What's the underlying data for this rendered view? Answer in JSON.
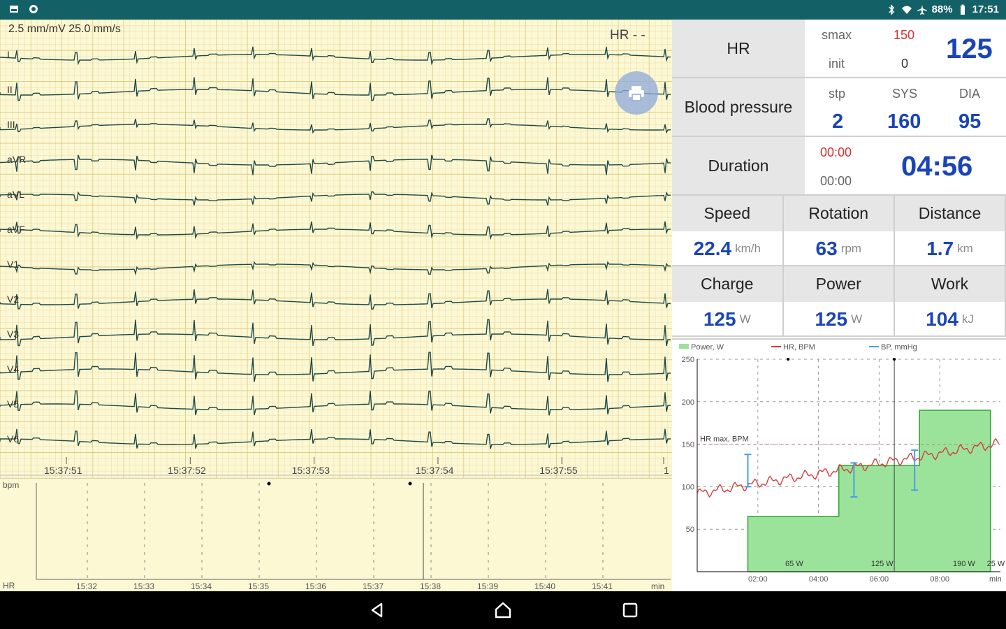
{
  "status_bar": {
    "left_icons": [
      "image-icon",
      "sync-icon"
    ],
    "right_icons": [
      "bluetooth-icon",
      "wifi-icon",
      "airplane-icon",
      "battery-icon"
    ],
    "battery": "88%",
    "time": "17:51"
  },
  "ecg": {
    "scale": "2.5 mm/mV  25.0 mm/s",
    "hr_indicator": "HR  - -",
    "leads": [
      "I",
      "II",
      "III",
      "aVR",
      "aVL",
      "aVF",
      "V1",
      "V2",
      "V3",
      "V4",
      "V5",
      "V6"
    ],
    "times": [
      "15:37:51",
      "15:37:52",
      "15:37:53",
      "15:37:54",
      "15:37:55",
      "1"
    ],
    "fab_icon": "print-icon"
  },
  "hr_trend": {
    "ylabel": "bpm",
    "bottom_label": "HR",
    "x_ticks": [
      "15:32",
      "15:33",
      "15:34",
      "15:35",
      "15:36",
      "15:37",
      "15:38",
      "15:39",
      "15:40",
      "15:41",
      "min"
    ]
  },
  "hr": {
    "label": "HR",
    "smax_label": "smax",
    "smax_value": "150",
    "init_label": "init",
    "init_value": "0",
    "value": "125"
  },
  "bp": {
    "label": "Blood pressure",
    "stp_label": "stp",
    "sys_label": "SYS",
    "dia_label": "DIA",
    "stp": "2",
    "sys": "160",
    "dia": "95"
  },
  "duration": {
    "label": "Duration",
    "red_time": "00:00",
    "gray_time": "00:00",
    "value": "04:56"
  },
  "metrics": [
    {
      "label": "Speed",
      "value": "22.4",
      "unit": "km/h"
    },
    {
      "label": "Rotation",
      "value": "63",
      "unit": "rpm"
    },
    {
      "label": "Distance",
      "value": "1.7",
      "unit": "km"
    },
    {
      "label": "Charge",
      "value": "125",
      "unit": "W"
    },
    {
      "label": "Power",
      "value": "125",
      "unit": "W"
    },
    {
      "label": "Work",
      "value": "104",
      "unit": "kJ"
    }
  ],
  "chart_data": {
    "type": "area",
    "legend": [
      "Power, W",
      "HR, BPM",
      "BP, mmHg"
    ],
    "y_ticks": [
      "250",
      "200",
      "150",
      "100",
      "50"
    ],
    "x_ticks": [
      "02:00",
      "04:00",
      "06:00",
      "08:00",
      "min"
    ],
    "ylim": [
      0,
      250
    ],
    "xlim": [
      0,
      10
    ],
    "annotation": "HR max, BPM",
    "hr_max": 150,
    "power_labels": [
      "65 W",
      "125 W",
      "190 W",
      "25 W"
    ],
    "power_steps": [
      {
        "x0": 1.67,
        "x1": 4.67,
        "y": 65
      },
      {
        "x0": 4.67,
        "x1": 7.33,
        "y": 125
      },
      {
        "x0": 7.33,
        "x1": 9.67,
        "y": 190
      }
    ],
    "bp_markers": [
      {
        "x": 1.67,
        "low": 100,
        "high": 138
      },
      {
        "x": 5.17,
        "low": 88,
        "high": 128
      },
      {
        "x": 7.17,
        "low": 96,
        "high": 143
      }
    ],
    "colors": {
      "power_fill": "#9be39b",
      "power_line": "#2ba52b",
      "hr_line": "#d43c3c",
      "bp_line": "#4aa0e0"
    }
  }
}
